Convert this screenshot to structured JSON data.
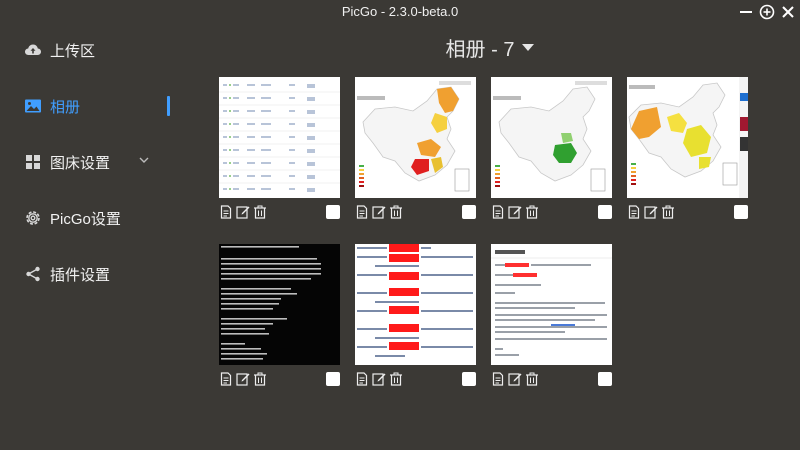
{
  "window": {
    "title": "PicGo - 2.3.0-beta.0"
  },
  "sidebar": {
    "items": [
      {
        "label": "上传区",
        "icon": "cloud-upload-icon"
      },
      {
        "label": "相册",
        "icon": "image-icon",
        "active": true
      },
      {
        "label": "图床设置",
        "icon": "grid-icon"
      },
      {
        "label": "PicGo设置",
        "icon": "gear-icon"
      },
      {
        "label": "插件设置",
        "icon": "share-icon"
      }
    ]
  },
  "album": {
    "title": "相册 - 7"
  },
  "gallery": {
    "items": [
      {
        "type": "table-screenshot"
      },
      {
        "type": "china-map-orange-red"
      },
      {
        "type": "china-map-green"
      },
      {
        "type": "china-map-yellow"
      },
      {
        "type": "terminal-screenshot"
      },
      {
        "type": "redacted-log-screenshot"
      },
      {
        "type": "document-screenshot"
      }
    ]
  },
  "colors": {
    "accent": "#409eff",
    "background": "#3b3935"
  }
}
